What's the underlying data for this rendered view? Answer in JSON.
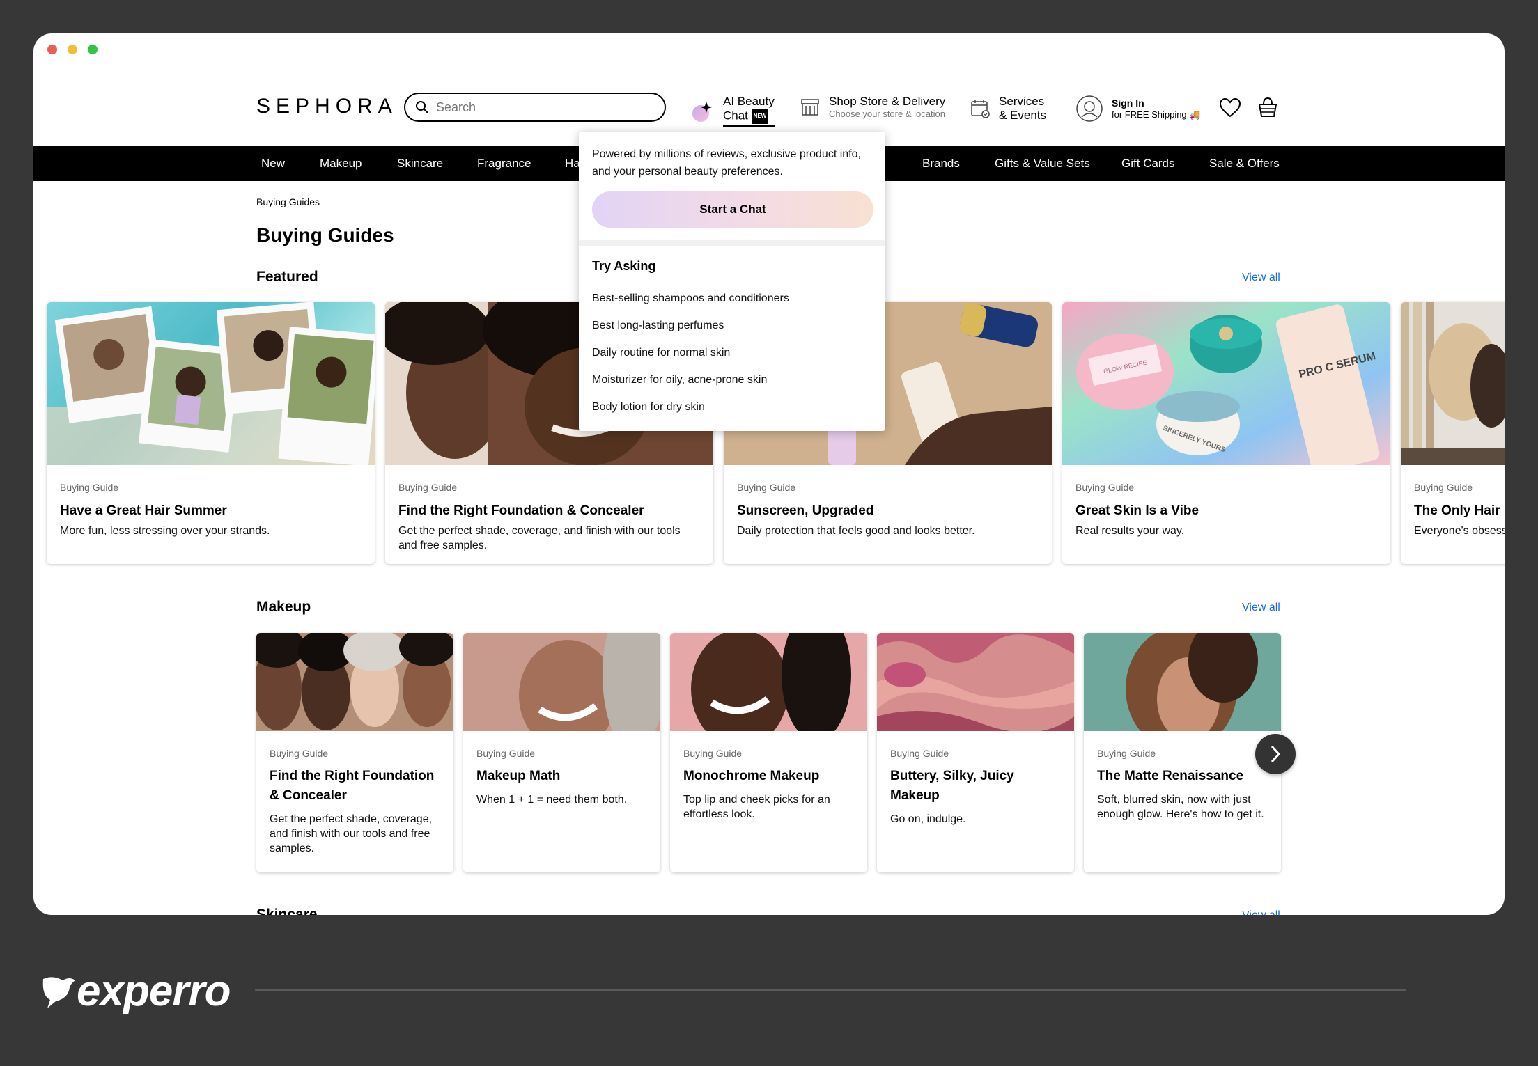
{
  "header": {
    "logo": "SEPHORA",
    "search_placeholder": "Search",
    "ai_chat": {
      "label": "AI Beauty Chat",
      "badge": "NEW"
    },
    "shop_store": {
      "title": "Shop Store & Delivery",
      "subtitle": "Choose your store & location"
    },
    "services": {
      "line1": "Services",
      "line2": "& Events"
    },
    "signin": {
      "title": "Sign In",
      "subtitle": "for FREE Shipping 🚚"
    }
  },
  "nav": [
    "New",
    "Makeup",
    "Skincare",
    "Fragrance",
    "Ha",
    "Brands",
    "Gifts & Value Sets",
    "Gift Cards",
    "Sale & Offers"
  ],
  "breadcrumb": "Buying Guides",
  "page_title": "Buying Guides",
  "featured": {
    "title": "Featured",
    "view_all": "View all",
    "cards": [
      {
        "kicker": "Buying Guide",
        "title": "Have a Great Hair Summer",
        "desc": "More fun, less stressing over your strands."
      },
      {
        "kicker": "Buying Guide",
        "title": "Find the Right Foundation & Concealer",
        "desc": "Get the perfect shade, coverage, and finish with our tools and free samples."
      },
      {
        "kicker": "Buying Guide",
        "title": "Sunscreen, Upgraded",
        "desc": "Daily protection that feels good and looks better."
      },
      {
        "kicker": "Buying Guide",
        "title": "Great Skin Is a Vibe",
        "desc": "Real results your way."
      },
      {
        "kicker": "Buying Guide",
        "title": "The Only Hair E",
        "desc": "Everyone's obsess"
      }
    ],
    "image_text": {
      "jar_label": "GLOW RECIPE",
      "serum_label": "PRO C SERUM",
      "small_jar": "SINCERELY YOURS"
    }
  },
  "makeup": {
    "title": "Makeup",
    "view_all": "View all",
    "cards": [
      {
        "kicker": "Buying Guide",
        "title": "Find the Right Foundation & Concealer",
        "desc": "Get the perfect shade, coverage, and finish with our tools and free samples."
      },
      {
        "kicker": "Buying Guide",
        "title": "Makeup Math",
        "desc": "When 1 + 1 = need them both."
      },
      {
        "kicker": "Buying Guide",
        "title": "Monochrome Makeup",
        "desc": "Top lip and cheek picks for an effortless look."
      },
      {
        "kicker": "Buying Guide",
        "title": "Buttery, Silky, Juicy Makeup",
        "desc": "Go on, indulge."
      },
      {
        "kicker": "Buying Guide",
        "title": "The Matte Renaissance",
        "desc": "Soft, blurred skin, now with just enough glow. Here's how to get it."
      }
    ]
  },
  "skincare": {
    "title": "Skincare",
    "view_all": "View all"
  },
  "popover": {
    "intro": "Powered by millions of reviews, exclusive product info, and your personal beauty preferences.",
    "button": "Start a Chat",
    "try_title": "Try Asking",
    "suggestions": [
      "Best-selling shampoos and conditioners",
      "Best long-lasting perfumes",
      "Daily routine for normal skin",
      "Moisturizer for oily, acne-prone skin",
      "Body lotion for dry skin"
    ]
  },
  "brand": {
    "name": "experro"
  },
  "colors": {
    "link": "#136bea",
    "frame": "#373737",
    "navbar": "#000000"
  }
}
